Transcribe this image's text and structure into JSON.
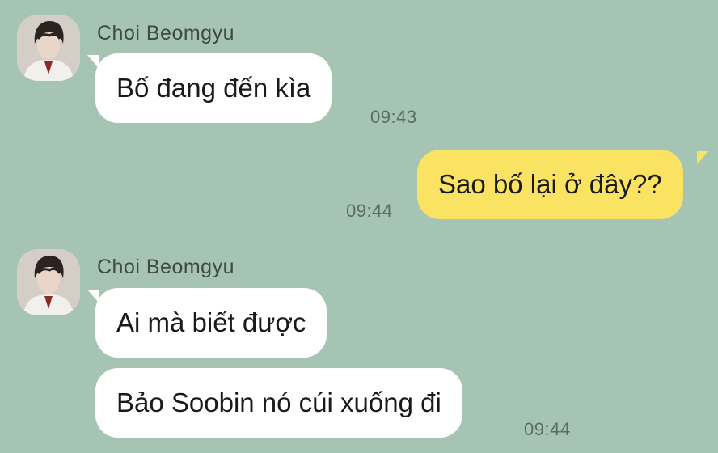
{
  "colors": {
    "background": "#a6c4b4",
    "incoming_bubble": "#ffffff",
    "outgoing_bubble": "#fae362",
    "timestamp": "#5c6b64",
    "sender_name": "#3f4a45"
  },
  "messages": {
    "group1": {
      "sender": "Choi Beomgyu",
      "avatar_icon": "profile-photo",
      "text": "Bố đang đến kìa",
      "time": "09:43"
    },
    "outgoing": {
      "text": "Sao bố lại ở đây??",
      "time": "09:44"
    },
    "group2": {
      "sender": "Choi Beomgyu",
      "avatar_icon": "profile-photo",
      "bubbles": [
        {
          "text": "Ai mà biết được"
        },
        {
          "text": "Bảo Soobin nó cúi xuống đi"
        }
      ],
      "time": "09:44"
    }
  }
}
